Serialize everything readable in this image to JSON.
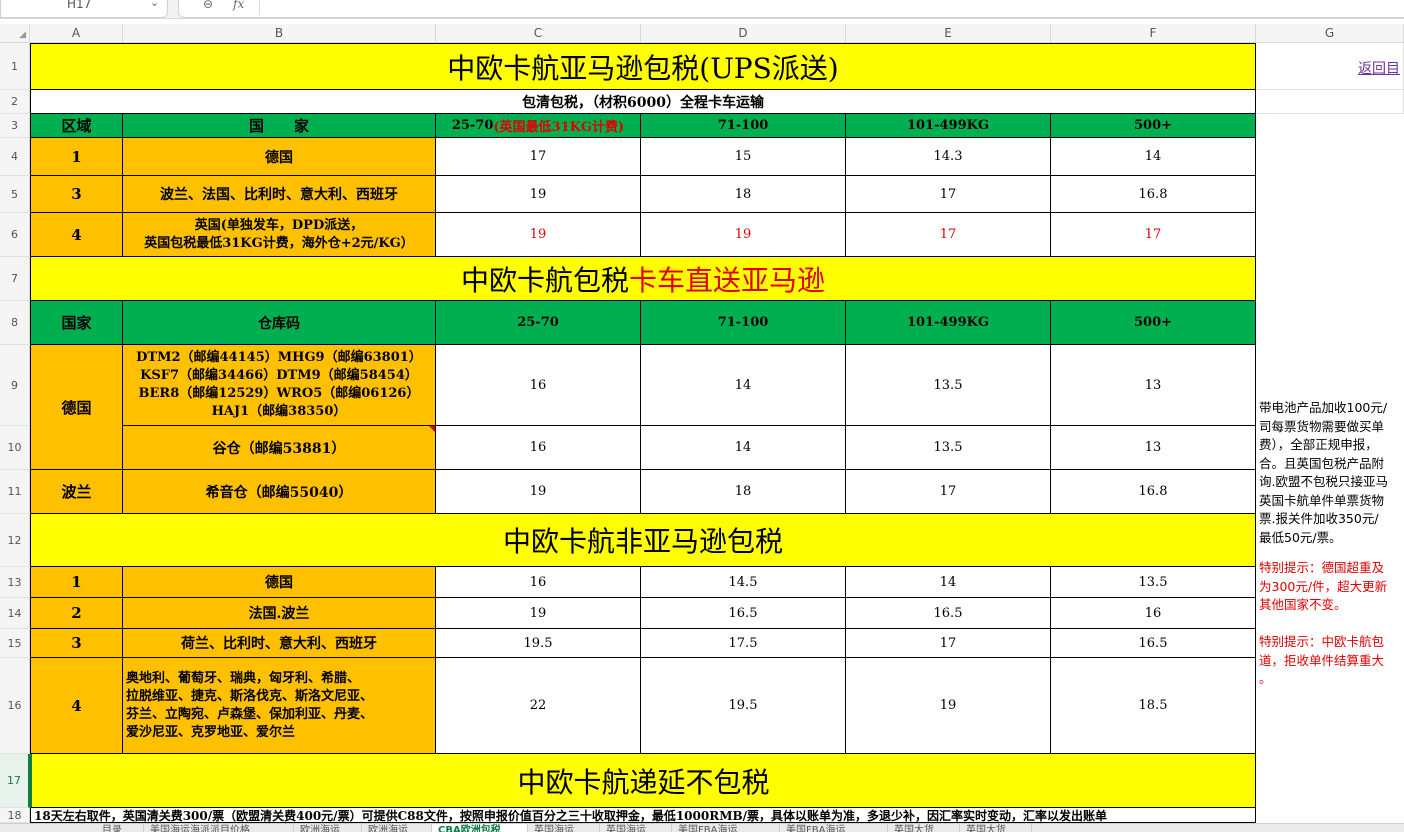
{
  "toolbar": {
    "name_box": "H17",
    "zoom_icon": "zoom-icon",
    "fx_label": "fx"
  },
  "columns": [
    "A",
    "B",
    "C",
    "D",
    "E",
    "F",
    "G"
  ],
  "rows": [
    "1",
    "2",
    "3",
    "4",
    "5",
    "6",
    "7",
    "8",
    "9",
    "10",
    "11",
    "12",
    "13",
    "14",
    "15",
    "16",
    "17",
    "18"
  ],
  "sheet": {
    "title1": "中欧卡航亚马逊包税(UPS派送)",
    "back_link": "返回目",
    "subtitle": "包清包税，（材积6000）全程卡车运输",
    "h1": {
      "region": "区域",
      "country": "国　　家",
      "c": "25-70",
      "c_note": "(英国最低31KG计费)",
      "d": "71-100",
      "e": "101-499KG",
      "f": "500+"
    },
    "t1_rows": [
      {
        "region": "1",
        "country": "德国",
        "c": "17",
        "d": "15",
        "e": "14.3",
        "f": "14"
      },
      {
        "region": "3",
        "country": "波兰、法国、比利时、意大利、西班牙",
        "c": "19",
        "d": "18",
        "e": "17",
        "f": "16.8"
      },
      {
        "region": "4",
        "country": "英国(单独发车，DPD派送，\n英国包税最低31KG计费，海外仓+2元/KG）",
        "c": "19",
        "d": "19",
        "e": "17",
        "f": "17"
      }
    ],
    "title2_black": "中欧卡航包税",
    "title2_red": "卡车直送亚马逊",
    "h2": {
      "country": "国家",
      "warehouse": "仓库码",
      "c": "25-70",
      "d": "71-100",
      "e": "101-499KG",
      "f": "500+"
    },
    "de_label": "德国",
    "t2_r9": {
      "warehouse": "DTM2（邮编44145）MHG9（邮编63801）\nKSF7（邮编34466）DTM9（邮编58454）\nBER8（邮编12529）WRO5（邮编06126）\nHAJ1（邮编38350）",
      "c": "16",
      "d": "14",
      "e": "13.5",
      "f": "13"
    },
    "t2_r10": {
      "warehouse": "谷仓（邮编53881）",
      "c": "16",
      "d": "14",
      "e": "13.5",
      "f": "13"
    },
    "t2_r11": {
      "country": "波兰",
      "warehouse": "希音仓（邮编55040）",
      "c": "19",
      "d": "18",
      "e": "17",
      "f": "16.8"
    },
    "title3": "中欧卡航非亚马逊包税",
    "t3_rows": [
      {
        "region": "1",
        "country": "德国",
        "c": "16",
        "d": "14.5",
        "e": "14",
        "f": "13.5"
      },
      {
        "region": "2",
        "country": "法国.波兰",
        "c": "19",
        "d": "16.5",
        "e": "16.5",
        "f": "16"
      },
      {
        "region": "3",
        "country": "荷兰、比利时、意大利、西班牙",
        "c": "19.5",
        "d": "17.5",
        "e": "17",
        "f": "16.5"
      },
      {
        "region": "4",
        "country": "奥地利、葡萄牙、瑞典，匈牙利、希腊、\n拉脱维亚、捷克、斯洛伐克、斯洛文尼亚、\n芬兰、立陶宛、卢森堡、保加利亚、丹麦、\n爱沙尼亚、克罗地亚、爱尔兰",
        "c": "22",
        "d": "19.5",
        "e": "19",
        "f": "18.5"
      }
    ],
    "title4": "中欧卡航递延不包税",
    "row18": "18天左右取件，英国清关费300/票（欧盟清关费400元/票）可提供C88文件，按照申报价值百分之三十收取押金，最低1000RMB/票，具体以账单为准，多退少补，因汇率实时变动，汇率以发出账单",
    "note_black": "带电池产品加收100元/\n司每票货物需要做买单\n费），全部正规申报，\n合。且英国包税产品附\n询.欧盟不包税只接亚马\n英国卡航单件单票货物\n票.报关件加收350元/\n最低50元/票。",
    "note_red1": "特别提示：德国超重及\n为300元/件，超大更新\n其他国家不变。",
    "note_red2": "特别提示：中欧卡航包\n道，拒收单件结算重大\n。"
  },
  "tabs": [
    "目录",
    "美国海运海派派目价格",
    "欧洲海运",
    "欧洲海运",
    "CBA欧洲包税",
    "英国海运",
    "英国海运",
    "美国FBA海运",
    "美国FBA海运",
    "英国大货",
    "英国大货"
  ]
}
